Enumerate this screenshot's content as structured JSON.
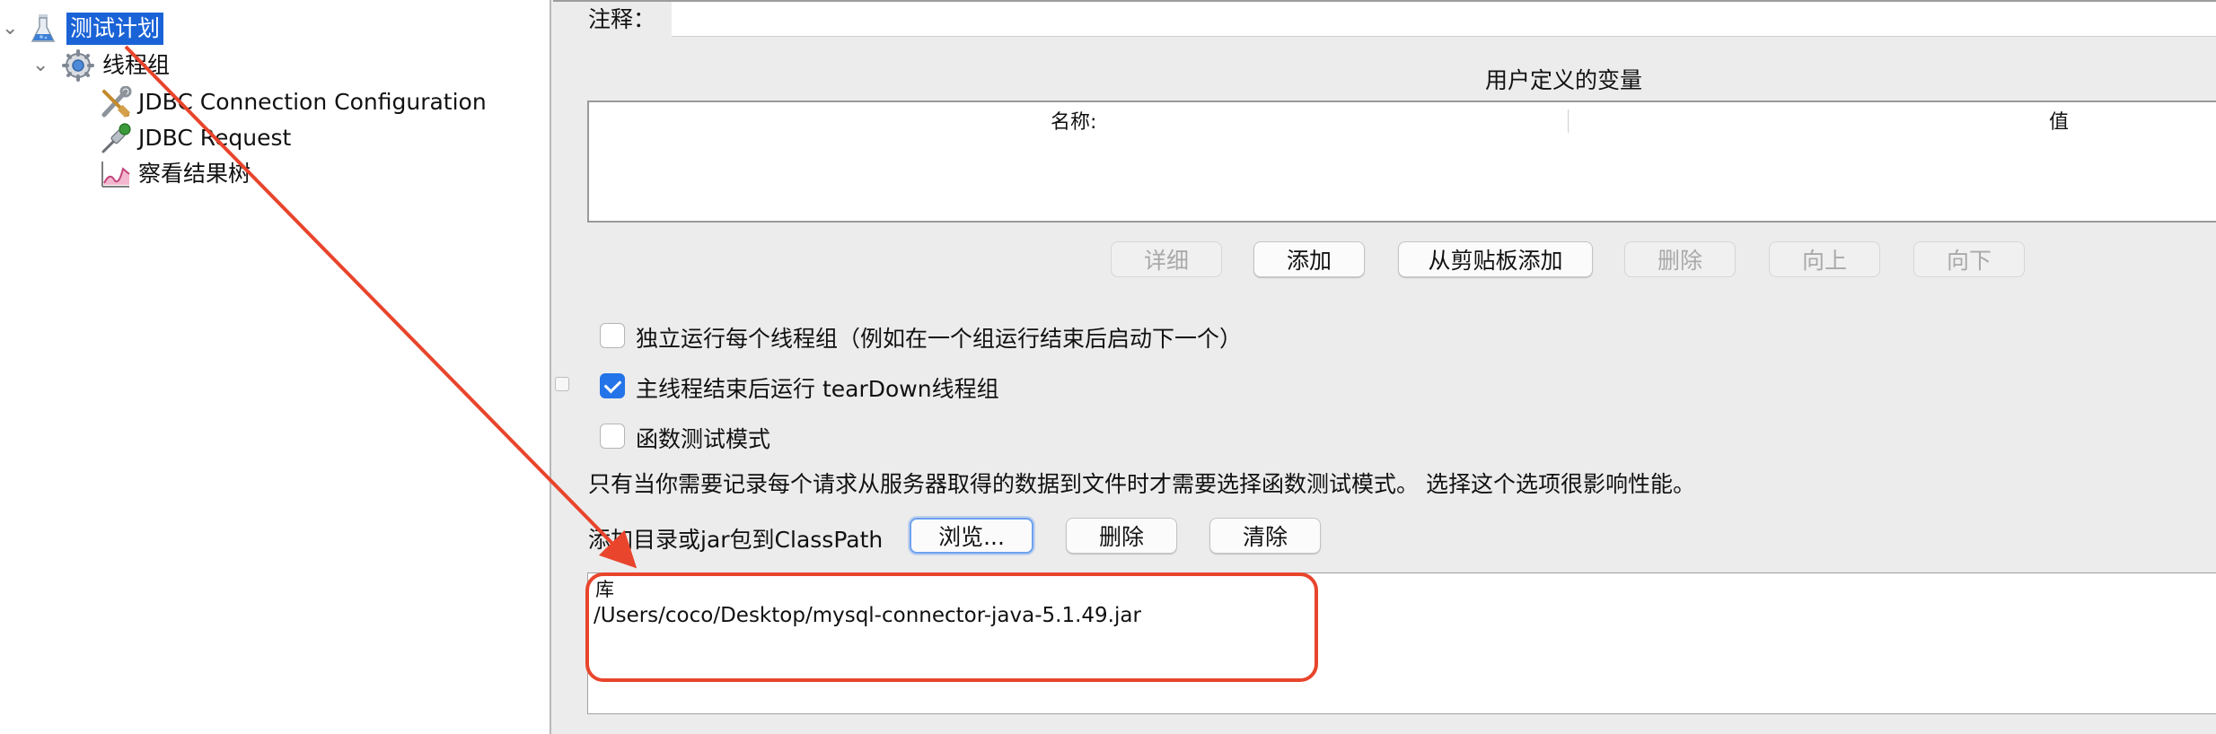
{
  "tree": {
    "items": [
      {
        "label": "测试计划",
        "icon": "test-plan-flask-icon",
        "expanded": true,
        "selected": true
      },
      {
        "label": "线程组",
        "icon": "thread-group-gear-icon",
        "expanded": true
      },
      {
        "label": "JDBC Connection Configuration",
        "icon": "config-tools-icon"
      },
      {
        "label": "JDBC Request",
        "icon": "sampler-pipette-icon"
      },
      {
        "label": "察看结果树",
        "icon": "listener-graph-icon"
      }
    ]
  },
  "form": {
    "comment_label": "注释：",
    "comment_value": "",
    "user_vars": {
      "title": "用户定义的变量",
      "columns": [
        "名称:",
        "值"
      ],
      "buttons": {
        "detail": "详细",
        "add": "添加",
        "add_from_clipboard": "从剪贴板添加",
        "delete": "删除",
        "move_up": "向上",
        "move_down": "向下"
      }
    },
    "options": {
      "serialize_threadgroups": {
        "label": "独立运行每个线程组（例如在一个组运行结束后启动下一个）",
        "checked": false
      },
      "teardown_on_shutdown": {
        "label": "主线程结束后运行 tearDown线程组",
        "checked": true
      },
      "functional_mode": {
        "label": "函数测试模式",
        "checked": false
      }
    },
    "functional_mode_note": "只有当你需要记录每个请求从服务器取得的数据到文件时才需要选择函数测试模式。 选择这个选项很影响性能。",
    "classpath": {
      "label": "添加目录或jar包到ClassPath",
      "browse_button": "浏览...",
      "delete_button": "删除",
      "clear_button": "清除",
      "library_header": "库",
      "libraries": [
        "/Users/coco/Desktop/mysql-connector-java-5.1.49.jar"
      ]
    }
  },
  "annotation": {
    "color": "#e8452c"
  },
  "colors": {
    "selection": "#1a63d6",
    "checkbox_checked": "#2374e8",
    "accent_focus": "#6ea1f0"
  }
}
